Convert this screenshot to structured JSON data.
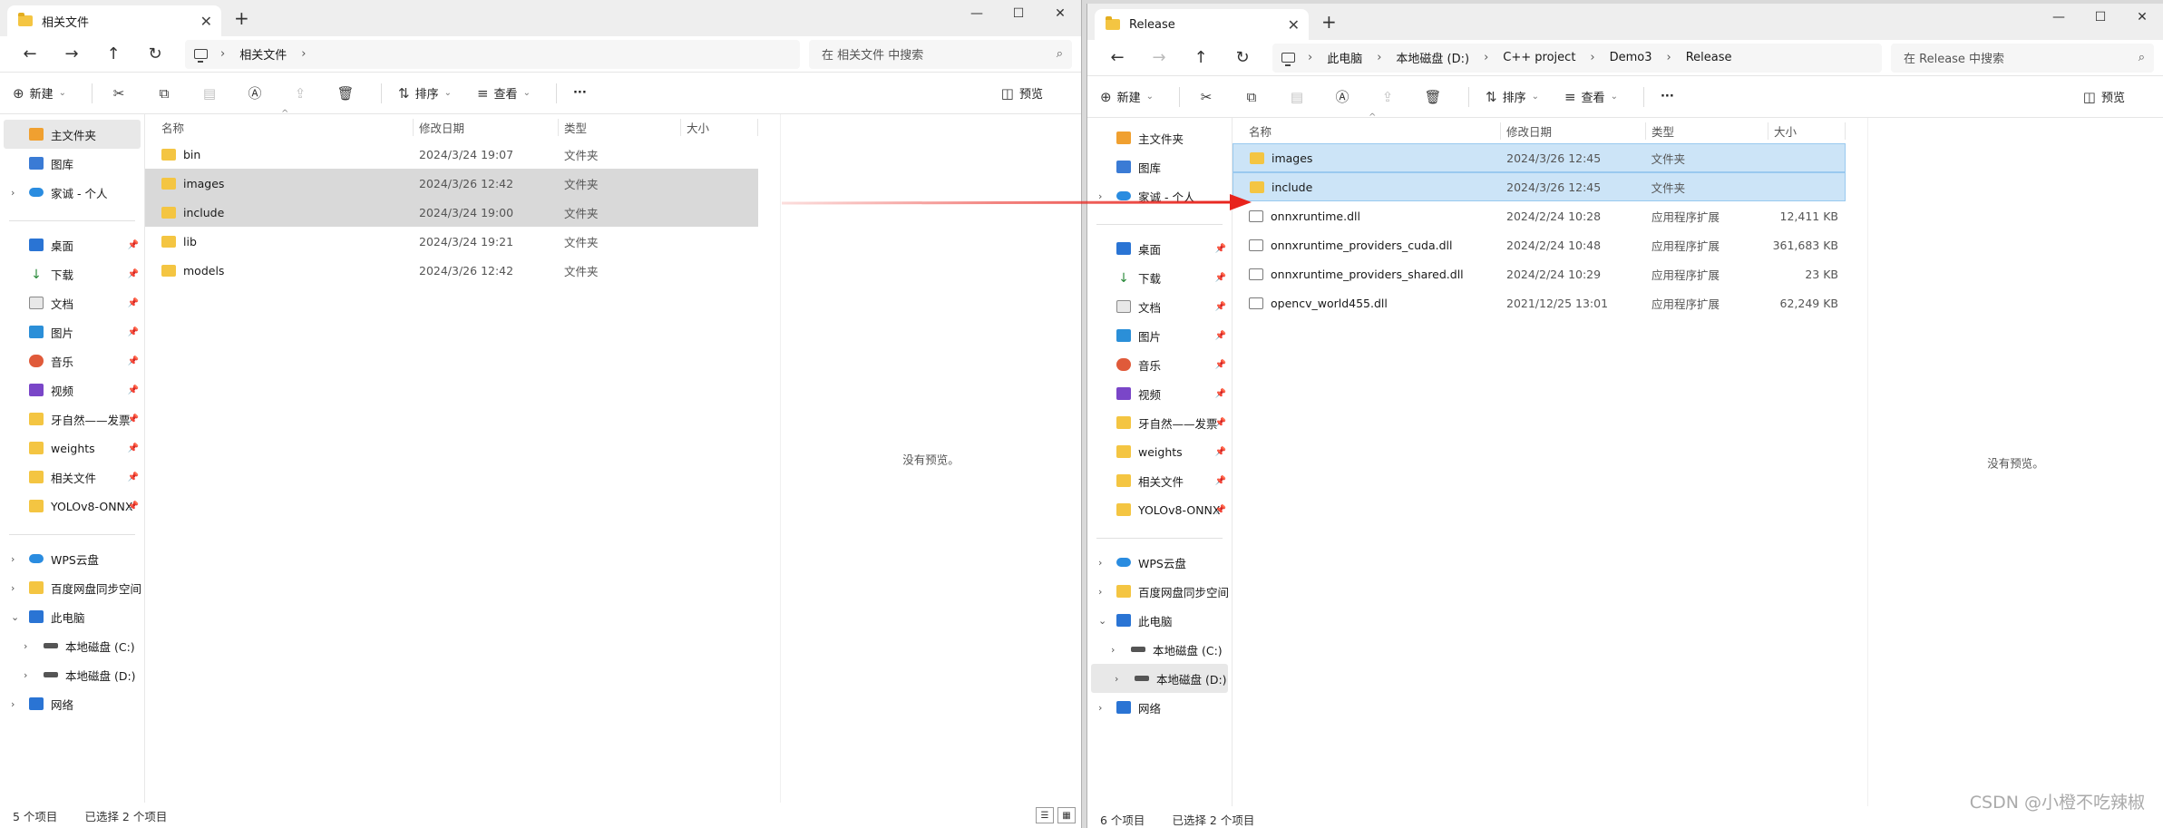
{
  "left": {
    "tab_title": "相关文件",
    "path": [
      "相关文件"
    ],
    "search_placeholder": "在 相关文件 中搜索",
    "toolbar": {
      "new": "新建",
      "sort": "排序",
      "view": "查看",
      "more": "···",
      "preview": "预览"
    },
    "sidebar": [
      {
        "label": "主文件夹",
        "icon": "home-icon",
        "active": true
      },
      {
        "label": "图库",
        "icon": "gallery-icon"
      },
      {
        "label": "家诚 - 个人",
        "icon": "cloud-icon",
        "chevron": true
      },
      {
        "gap": true
      },
      {
        "label": "桌面",
        "icon": "desktop-icon",
        "pin": true
      },
      {
        "label": "下载",
        "icon": "download-icon",
        "pin": true
      },
      {
        "label": "文档",
        "icon": "document-icon",
        "pin": true
      },
      {
        "label": "图片",
        "icon": "pictures-icon",
        "pin": true
      },
      {
        "label": "音乐",
        "icon": "music-icon",
        "pin": true
      },
      {
        "label": "视频",
        "icon": "video-icon",
        "pin": true
      },
      {
        "label": "牙自然——发票",
        "icon": "folder-icon",
        "pin": true
      },
      {
        "label": "weights",
        "icon": "folder-icon",
        "pin": true
      },
      {
        "label": "相关文件",
        "icon": "folder-icon",
        "pin": true
      },
      {
        "label": "YOLOv8-ONNX",
        "icon": "folder-icon",
        "pin": true
      },
      {
        "gap": true
      },
      {
        "label": "WPS云盘",
        "icon": "cloud-icon",
        "chevron": true
      },
      {
        "label": "百度网盘同步空间",
        "icon": "folder-icon",
        "chevron": true
      },
      {
        "label": "此电脑",
        "icon": "pc-icon",
        "chevron": true,
        "expanded": true
      },
      {
        "label": "本地磁盘 (C:)",
        "icon": "drive-icon",
        "chevron": true,
        "indent": true
      },
      {
        "label": "本地磁盘 (D:)",
        "icon": "drive-icon",
        "chevron": true,
        "indent": true
      },
      {
        "label": "网络",
        "icon": "network-icon",
        "chevron": true
      }
    ],
    "columns": {
      "name": "名称",
      "date": "修改日期",
      "type": "类型",
      "size": "大小"
    },
    "files": [
      {
        "name": "bin",
        "date": "2024/3/24 19:07",
        "type": "文件夹",
        "size": "",
        "kind": "folder"
      },
      {
        "name": "images",
        "date": "2024/3/26 12:42",
        "type": "文件夹",
        "size": "",
        "kind": "folder",
        "selected": true
      },
      {
        "name": "include",
        "date": "2024/3/24 19:00",
        "type": "文件夹",
        "size": "",
        "kind": "folder",
        "selected": true
      },
      {
        "name": "lib",
        "date": "2024/3/24 19:21",
        "type": "文件夹",
        "size": "",
        "kind": "folder"
      },
      {
        "name": "models",
        "date": "2024/3/26 12:42",
        "type": "文件夹",
        "size": "",
        "kind": "folder"
      }
    ],
    "preview_text": "没有预览。",
    "status": {
      "count": "5 个项目",
      "selected": "已选择 2 个项目"
    }
  },
  "right": {
    "tab_title": "Release",
    "path": [
      "此电脑",
      "本地磁盘 (D:)",
      "C++ project",
      "Demo3",
      "Release"
    ],
    "search_placeholder": "在 Release 中搜索",
    "toolbar": {
      "new": "新建",
      "sort": "排序",
      "view": "查看",
      "more": "···",
      "preview": "预览"
    },
    "sidebar": [
      {
        "label": "主文件夹",
        "icon": "home-icon"
      },
      {
        "label": "图库",
        "icon": "gallery-icon"
      },
      {
        "label": "家诚 - 个人",
        "icon": "cloud-icon",
        "chevron": true
      },
      {
        "gap": true
      },
      {
        "label": "桌面",
        "icon": "desktop-icon",
        "pin": true
      },
      {
        "label": "下载",
        "icon": "download-icon",
        "pin": true
      },
      {
        "label": "文档",
        "icon": "document-icon",
        "pin": true
      },
      {
        "label": "图片",
        "icon": "pictures-icon",
        "pin": true
      },
      {
        "label": "音乐",
        "icon": "music-icon",
        "pin": true
      },
      {
        "label": "视频",
        "icon": "video-icon",
        "pin": true
      },
      {
        "label": "牙自然——发票",
        "icon": "folder-icon",
        "pin": true
      },
      {
        "label": "weights",
        "icon": "folder-icon",
        "pin": true
      },
      {
        "label": "相关文件",
        "icon": "folder-icon",
        "pin": true
      },
      {
        "label": "YOLOv8-ONNX",
        "icon": "folder-icon",
        "pin": true
      },
      {
        "gap": true
      },
      {
        "label": "WPS云盘",
        "icon": "cloud-icon",
        "chevron": true
      },
      {
        "label": "百度网盘同步空间",
        "icon": "folder-icon",
        "chevron": true
      },
      {
        "label": "此电脑",
        "icon": "pc-icon",
        "chevron": true,
        "expanded": true
      },
      {
        "label": "本地磁盘 (C:)",
        "icon": "drive-icon",
        "chevron": true,
        "indent": true
      },
      {
        "label": "本地磁盘 (D:)",
        "icon": "drive-icon",
        "chevron": true,
        "indent": true,
        "active": true
      },
      {
        "label": "网络",
        "icon": "network-icon",
        "chevron": true
      }
    ],
    "columns": {
      "name": "名称",
      "date": "修改日期",
      "type": "类型",
      "size": "大小"
    },
    "files": [
      {
        "name": "images",
        "date": "2024/3/26 12:45",
        "type": "文件夹",
        "size": "",
        "kind": "folder",
        "selected": true
      },
      {
        "name": "include",
        "date": "2024/3/26 12:45",
        "type": "文件夹",
        "size": "",
        "kind": "folder",
        "selected": true
      },
      {
        "name": "onnxruntime.dll",
        "date": "2024/2/24 10:28",
        "type": "应用程序扩展",
        "size": "12,411 KB",
        "kind": "dll"
      },
      {
        "name": "onnxruntime_providers_cuda.dll",
        "date": "2024/2/24 10:48",
        "type": "应用程序扩展",
        "size": "361,683 KB",
        "kind": "dll"
      },
      {
        "name": "onnxruntime_providers_shared.dll",
        "date": "2024/2/24 10:29",
        "type": "应用程序扩展",
        "size": "23 KB",
        "kind": "dll"
      },
      {
        "name": "opencv_world455.dll",
        "date": "2021/12/25 13:01",
        "type": "应用程序扩展",
        "size": "62,249 KB",
        "kind": "dll"
      }
    ],
    "preview_text": "没有预览。",
    "status": {
      "count": "6 个项目",
      "selected": "已选择 2 个项目"
    }
  },
  "arrow_color": "#e8231c",
  "watermark": "CSDN @小橙不吃辣椒"
}
